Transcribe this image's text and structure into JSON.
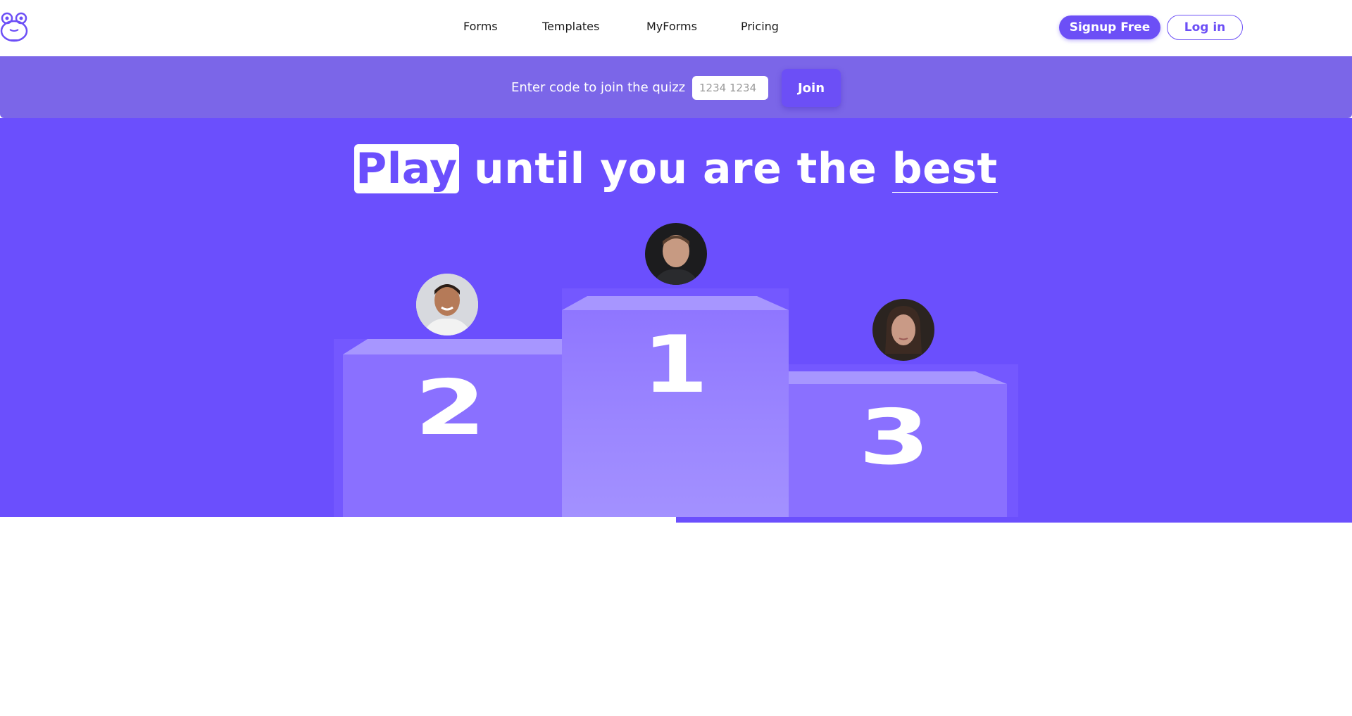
{
  "header": {
    "nav": [
      "Forms",
      "Templates",
      "MyForms",
      "Pricing"
    ],
    "signup_label": "Signup Free",
    "login_label": "Log in"
  },
  "join": {
    "label": "Enter code to join the quizz",
    "placeholder": "1234 1234",
    "button_label": "Join"
  },
  "hero": {
    "headline_play": "Play",
    "headline_middle": " until you are the ",
    "headline_best": "best"
  },
  "podium": {
    "first": "1",
    "second": "2",
    "third": "3"
  },
  "colors": {
    "brand": "#6c4ff6",
    "hero_bg": "#6b4ffd",
    "joinbar_bg": "#7b66e8"
  }
}
